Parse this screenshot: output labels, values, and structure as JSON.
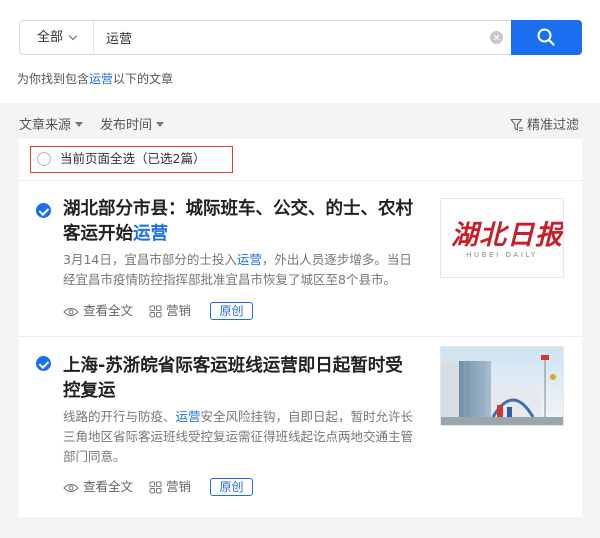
{
  "search": {
    "scope_label": "全部",
    "query": "运营",
    "found_prefix": "为你找到包含",
    "found_keyword": "运营",
    "found_suffix": "以下的文章"
  },
  "filters": {
    "source_label": "文章来源",
    "time_label": "发布时间",
    "precise_label": "精准过滤"
  },
  "select_all_label": "当前页面全选（已选2篇）",
  "articles": [
    {
      "title_main": "湖北部分市县：城际班车、公交、的士、农村客运开始",
      "title_keyword": "运营",
      "desc_a": "3月14日，宜昌市部分的士投入",
      "desc_keyword": "运营",
      "desc_b": "，外出人员逐步增多。当日经宜昌市疫情防控指挥部批准宜昌市恢复了城区至8个县市。",
      "view_label": "查看全文",
      "category_label": "营销",
      "tag_label": "原创",
      "thumb_text": "湖北日报",
      "thumb_subtext": "HUBEI DAILY"
    },
    {
      "title_main": "上海-苏浙皖省际客运班线运营即日起暂时受控复运",
      "desc_a": "线路的开行与防疫、",
      "desc_keyword": "运营",
      "desc_b": "安全风险挂钩，自即日起，暂时允许长三角地区省际客运班线受控复运需征得班线起讫点两地交通主管部门同意。",
      "view_label": "查看全文",
      "category_label": "营销",
      "tag_label": "原创"
    }
  ],
  "colors": {
    "accent": "#1a6ff0",
    "highlight_box": "#e03b3b",
    "logo_red": "#c8202a"
  }
}
